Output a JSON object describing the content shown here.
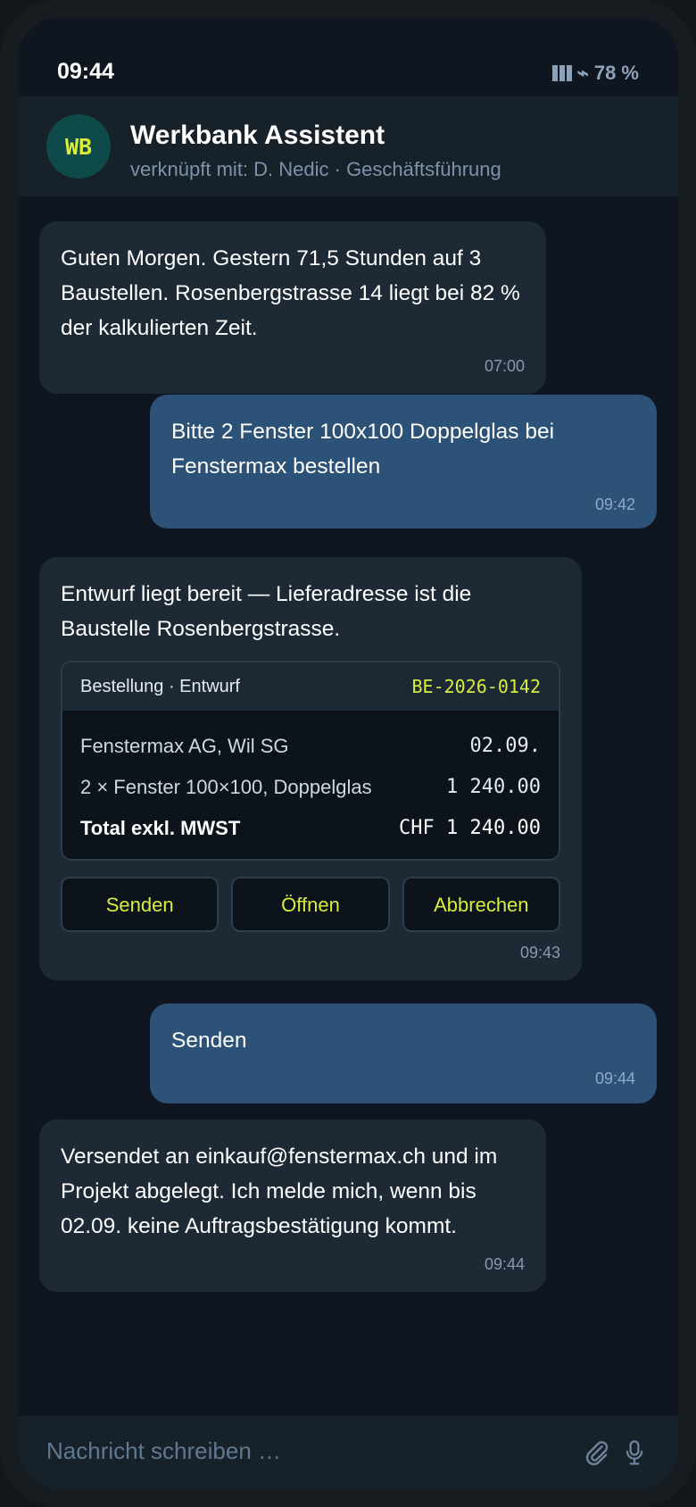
{
  "status": {
    "time": "09:44",
    "battery": "78 %"
  },
  "header": {
    "avatar": "WB",
    "title": "Werkbank Assistent",
    "subtitle": "verknüpft mit: D. Nedic · Geschäftsführung"
  },
  "messages": [
    {
      "from": "bot",
      "text": "Guten Morgen. Gestern 71,5 Stunden auf 3 Baustellen. Rosenbergstrasse 14 liegt bei 82 % der kalkulierten Zeit.",
      "time": "07:00"
    },
    {
      "from": "me",
      "text": "Bitte 2 Fenster 100x100 Doppelglas bei Fenstermax bestellen",
      "time": "09:42"
    },
    {
      "from": "bot",
      "text": "Entwurf liegt bereit — Lieferadresse ist die Baustelle Rosenbergstrasse.",
      "time": "09:43",
      "card": {
        "label": "Bestellung · Entwurf",
        "ref": "BE-2026-0142",
        "rows": [
          {
            "label": "Fenstermax AG, Wil SG",
            "value": "02.09."
          },
          {
            "label": "2 × Fenster 100×100, Doppelglas",
            "value": "1 240.00"
          },
          {
            "label": "Total exkl. MWST",
            "value": "CHF 1 240.00"
          }
        ],
        "actions": [
          "Senden",
          "Öffnen",
          "Abbrechen"
        ]
      }
    },
    {
      "from": "me",
      "text": "Senden",
      "time": "09:44"
    },
    {
      "from": "bot",
      "text": "Versendet an einkauf@fenstermax.ch und im Projekt abgelegt. Ich melde mich, wenn bis 02.09. keine Auftragsbestätigung kommt.",
      "time": "09:44"
    }
  ],
  "composer": {
    "placeholder": "Nachricht schreiben …"
  },
  "icons": {
    "signal": "signal-icon",
    "charging": "charging-icon",
    "attach": "paperclip-icon",
    "mic": "microphone-icon"
  },
  "colors": {
    "accent": "#d8ee3a",
    "bot_bubble": "#1d2935",
    "user_bubble": "#2c5277",
    "background": "#0f1620"
  }
}
